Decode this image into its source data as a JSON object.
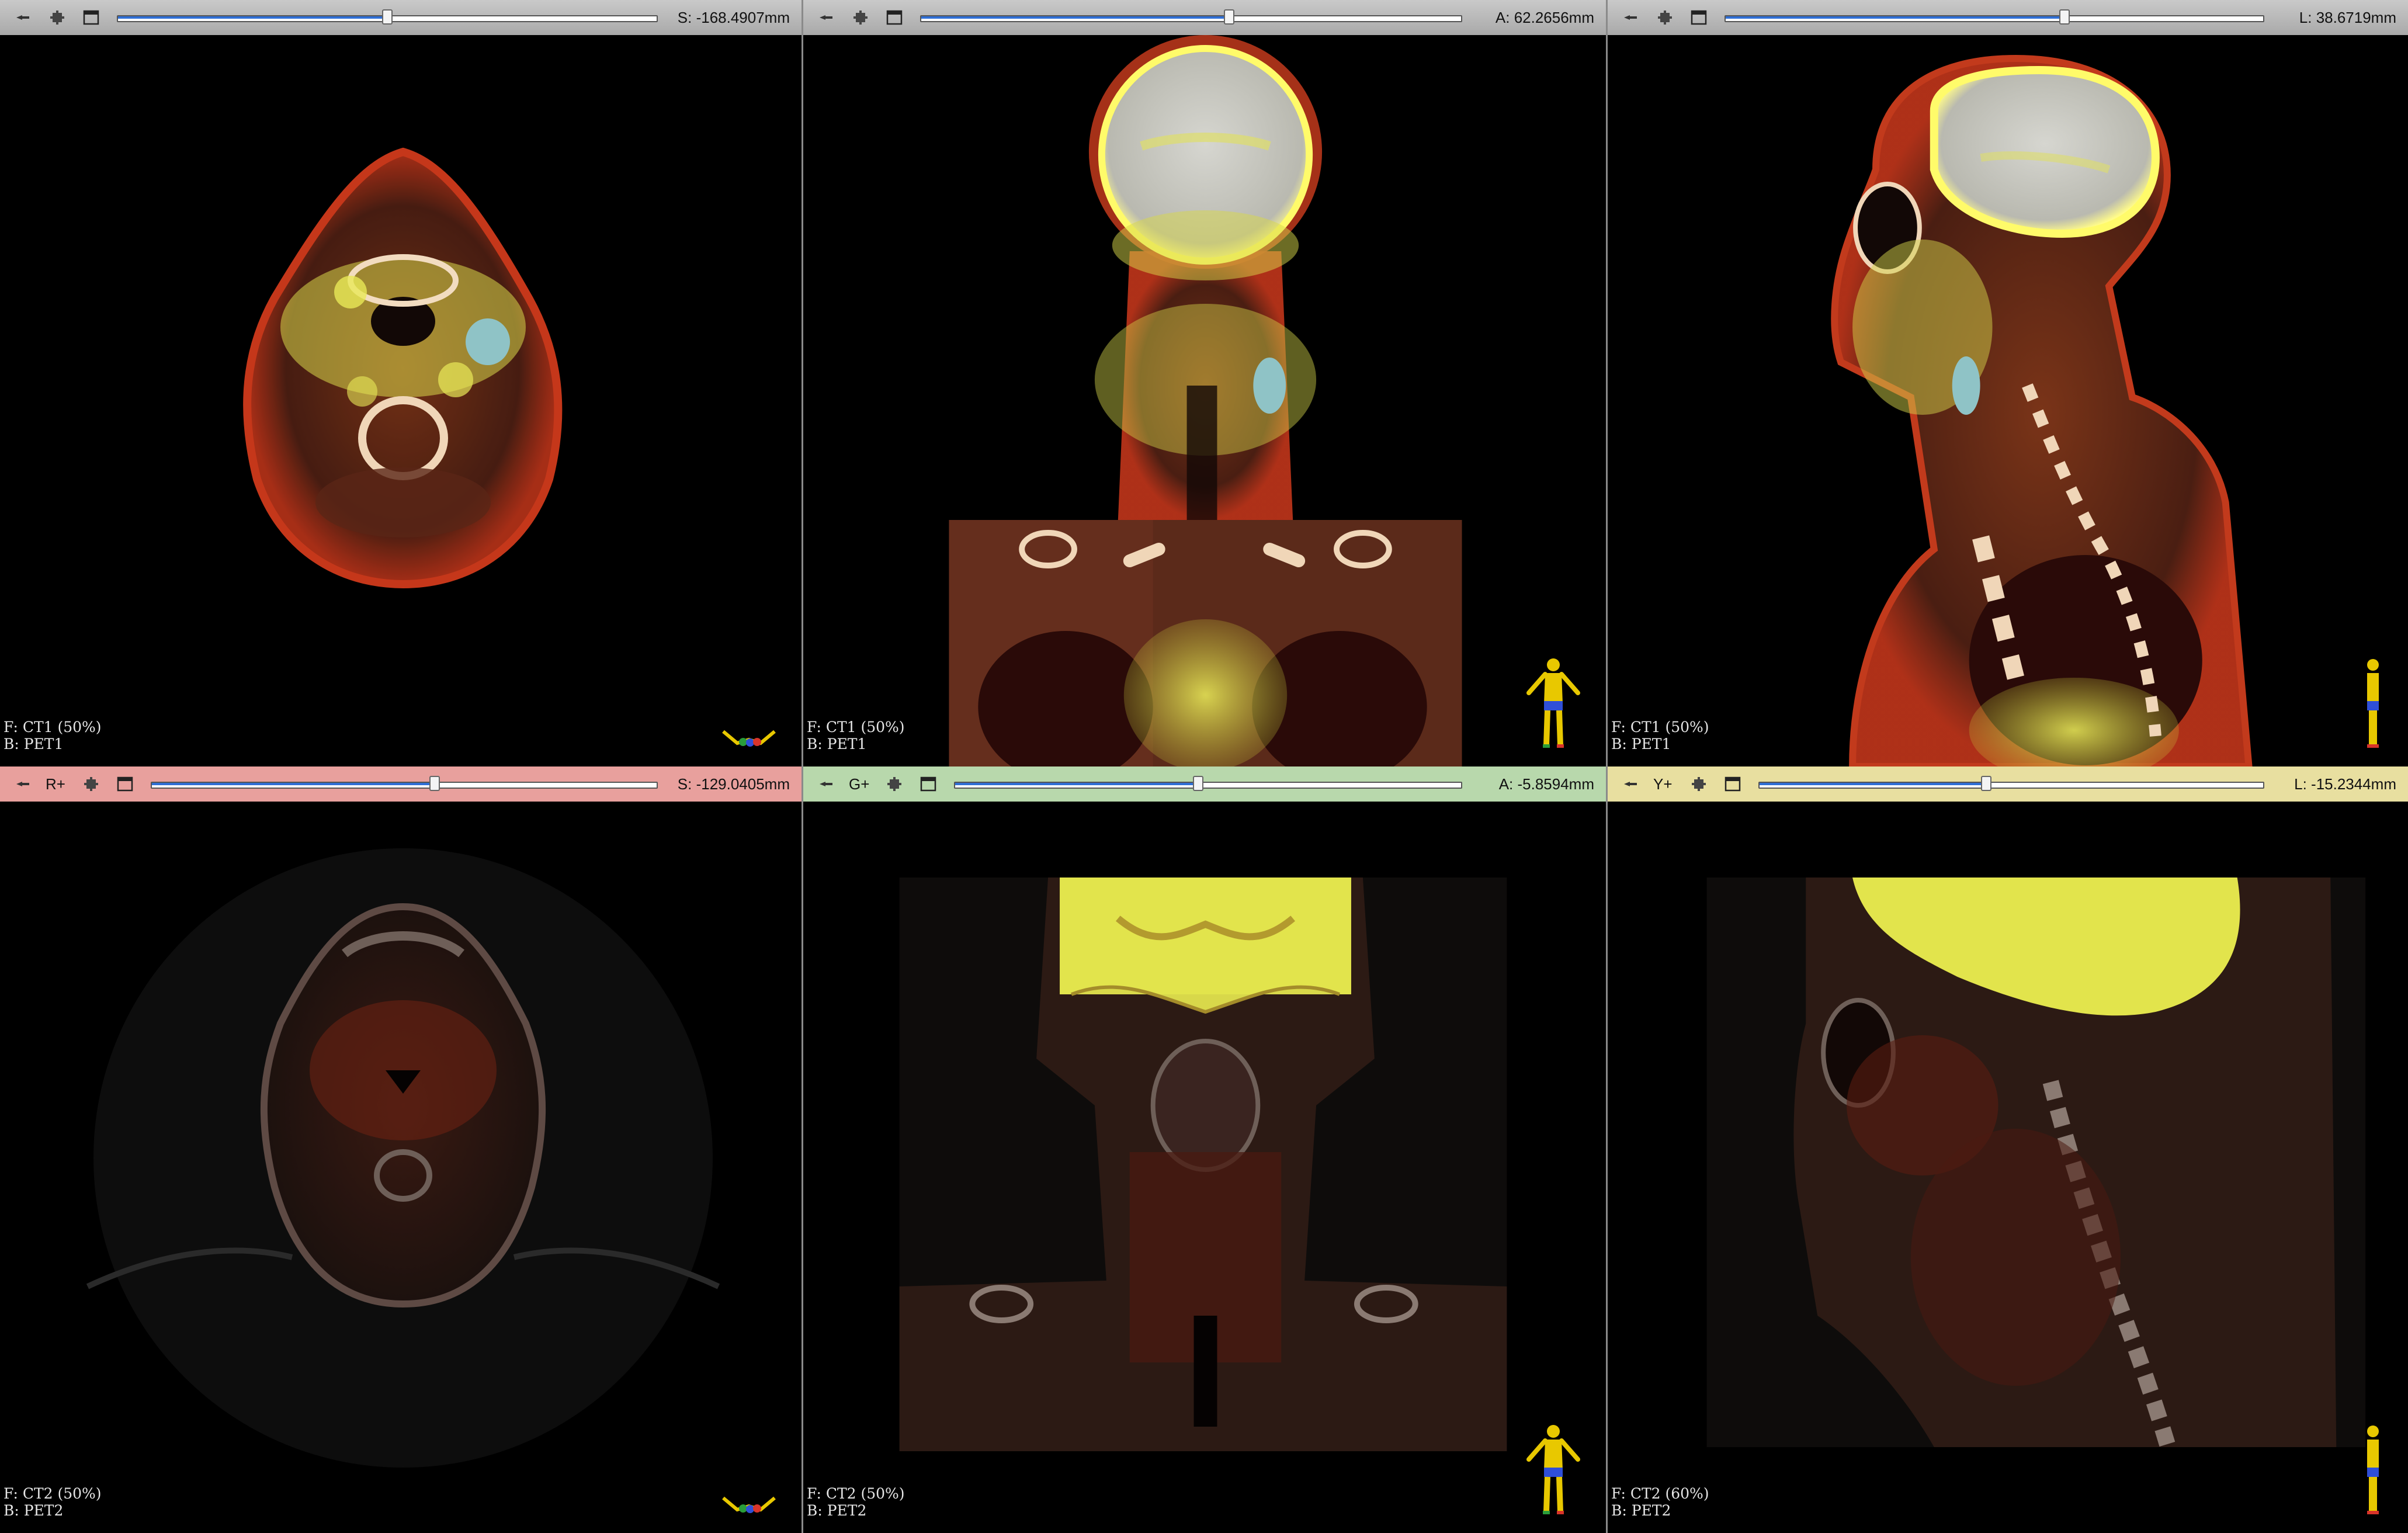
{
  "views": [
    {
      "id": "top-axial",
      "bar_style": "gray",
      "name": "",
      "offset": "S: -168.4907mm",
      "slider_value": 0.5,
      "foreground": "F: CT1 (50%)",
      "background": "B: PET1",
      "orientation": "axial-markers"
    },
    {
      "id": "top-coronal",
      "bar_style": "gray",
      "name": "",
      "offset": "A: 62.2656mm",
      "slider_value": 0.57,
      "foreground": "F: CT1 (50%)",
      "background": "B: PET1",
      "orientation": "human-coronal"
    },
    {
      "id": "top-sagittal",
      "bar_style": "gray",
      "name": "",
      "offset": "L: 38.6719mm",
      "slider_value": 0.63,
      "foreground": "F: CT1 (50%)",
      "background": "B: PET1",
      "orientation": "human-sagittal"
    },
    {
      "id": "bottom-axial",
      "bar_style": "red",
      "name": "R+",
      "offset": "S: -129.0405mm",
      "slider_value": 0.56,
      "foreground": "F: CT2 (50%)",
      "background": "B: PET2",
      "orientation": "axial-markers"
    },
    {
      "id": "bottom-coronal",
      "bar_style": "green",
      "name": "G+",
      "offset": "A: -5.8594mm",
      "slider_value": 0.48,
      "foreground": "F: CT2 (50%)",
      "background": "B: PET2",
      "orientation": "human-coronal"
    },
    {
      "id": "bottom-sagittal",
      "bar_style": "yellow",
      "name": "Y+",
      "offset": "L: -15.2344mm",
      "slider_value": 0.45,
      "foreground": "F: CT2 (60%)",
      "background": "B: PET2",
      "orientation": "human-sagittal"
    }
  ],
  "colors": {
    "red_bar": "#e8a09d",
    "green_bar": "#b8d8ac",
    "yellow_bar": "#e8dfa0",
    "gray_bar": "#b9b9b9",
    "slider_fill": "#2f6fd6",
    "pet_hot": "#e8e84a",
    "pet_warm": "#b3461a",
    "tissue": "#3b1a12"
  },
  "icons": {
    "pin": "pin-icon",
    "link": "link-icon",
    "window": "window-icon"
  }
}
